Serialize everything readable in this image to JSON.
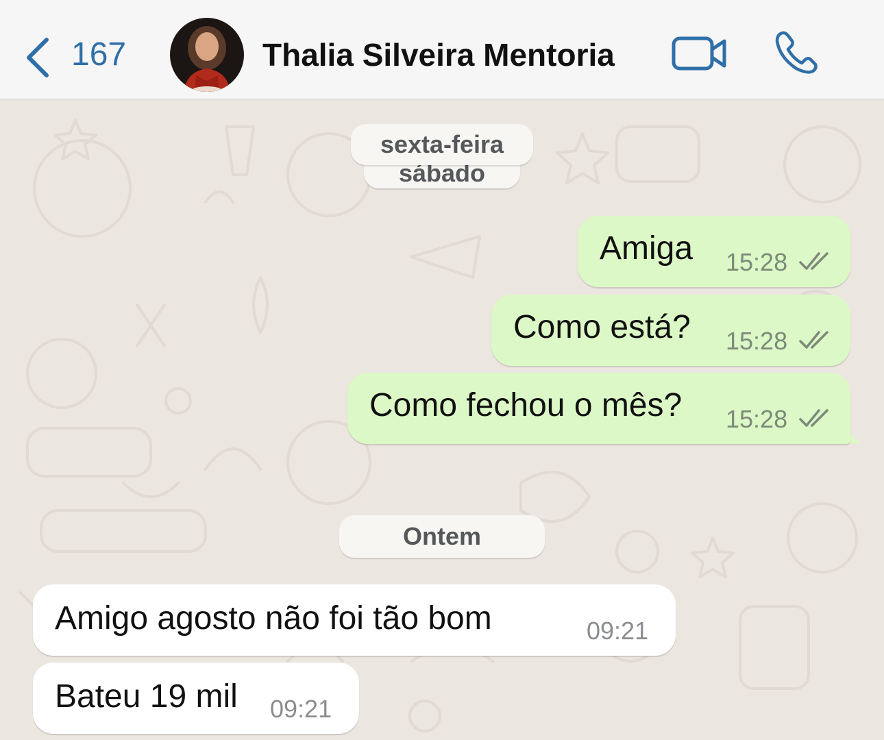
{
  "header": {
    "back_count": "167",
    "contact_name": "Thalia Silveira Mentoria"
  },
  "date_chips": {
    "first": "sexta-feira",
    "second": "sábado",
    "third": "Ontem"
  },
  "messages": [
    {
      "direction": "outgoing",
      "text": "Amiga",
      "time": "15:28",
      "status": "read-double-check"
    },
    {
      "direction": "outgoing",
      "text": "Como está?",
      "time": "15:28",
      "status": "read-double-check"
    },
    {
      "direction": "outgoing",
      "text": "Como fechou o mês?",
      "time": "15:28",
      "status": "read-double-check"
    },
    {
      "direction": "incoming",
      "text": "Amigo agosto não foi tão bom",
      "time": "09:21"
    },
    {
      "direction": "incoming",
      "text": "Bateu 19 mil",
      "time": "09:21"
    }
  ],
  "colors": {
    "accent": "#2f6fa8",
    "outgoing_bubble": "#dcf8c6",
    "incoming_bubble": "#ffffff",
    "chat_background": "#ebe6df"
  },
  "icons": [
    "chevron-left-icon",
    "video-camera-icon",
    "phone-icon",
    "double-check-icon"
  ]
}
